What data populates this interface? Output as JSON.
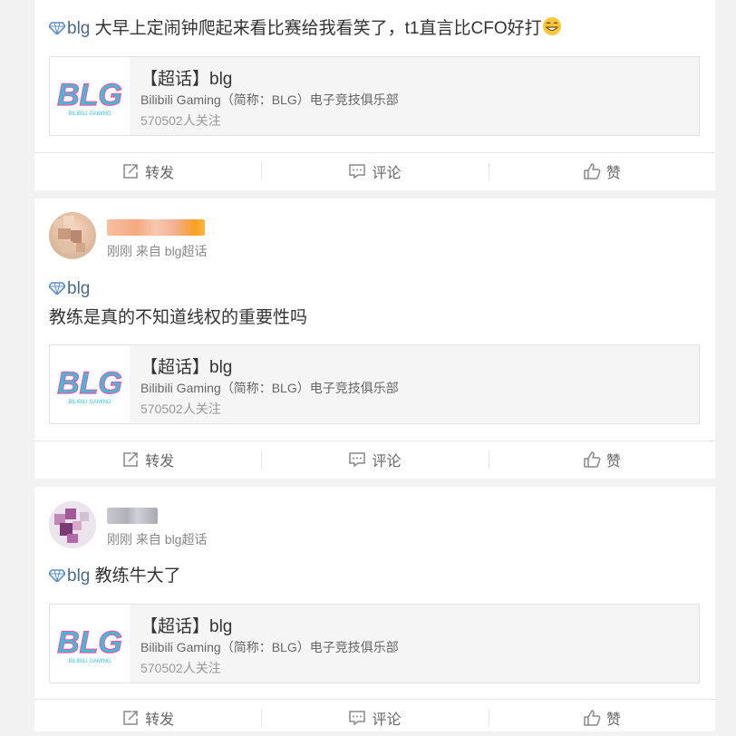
{
  "posts": [
    {
      "text": "大早上定闹钟爬起来看比赛给我看笑了，t1直言比CFO好打",
      "topic_tag": "blg",
      "topic_card": {
        "title": "【超话】blg",
        "description": "Bilibili Gaming（简称：BLG）电子竞技俱乐部",
        "followers": "570502人关注",
        "logo_text": "BLG",
        "logo_sub": "BILIBILI GAMING"
      }
    },
    {
      "meta": "刚刚 来自 blg超话",
      "topic_tag": "blg",
      "text": "教练是真的不知道线权的重要性吗",
      "topic_card": {
        "title": "【超话】blg",
        "description": "Bilibili Gaming（简称：BLG）电子竞技俱乐部",
        "followers": "570502人关注",
        "logo_text": "BLG",
        "logo_sub": "BILIBILI GAMING"
      }
    },
    {
      "meta": "刚刚 来自 blg超话",
      "topic_tag": "blg",
      "text": "教练牛大了",
      "topic_card": {
        "title": "【超话】blg",
        "description": "Bilibili Gaming（简称：BLG）电子竞技俱乐部",
        "followers": "570502人关注",
        "logo_text": "BLG",
        "logo_sub": "BILIBILI GAMING"
      }
    }
  ],
  "actions": {
    "repost": "转发",
    "comment": "评论",
    "like": "赞"
  },
  "colors": {
    "topic_link": "#4a6a8a",
    "logo_cyan": "#35c0e0",
    "logo_pink": "#f0569a"
  }
}
